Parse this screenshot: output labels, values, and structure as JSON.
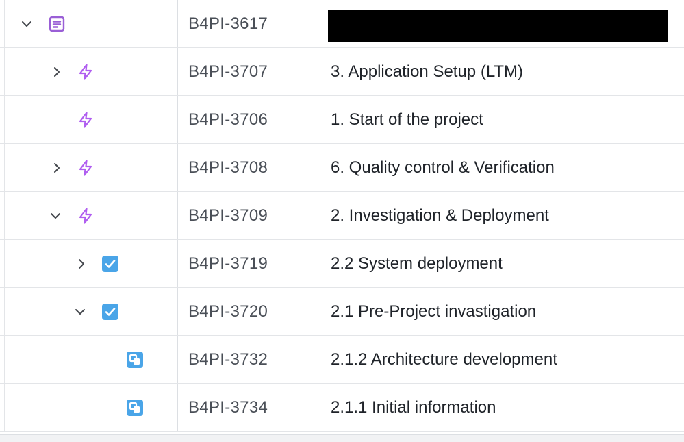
{
  "rows": [
    {
      "key": "B4PI-3617",
      "summary": "",
      "summary_redacted": true,
      "type_icon": "page-icon",
      "expander": "chevron-down-icon",
      "depth": 0
    },
    {
      "key": "B4PI-3707",
      "summary": "3. Application Setup (LTM)",
      "type_icon": "lightning-icon",
      "expander": "chevron-right-icon",
      "depth": 1
    },
    {
      "key": "B4PI-3706",
      "summary": "1. Start of the project",
      "type_icon": "lightning-icon",
      "expander": "",
      "depth": 1
    },
    {
      "key": "B4PI-3708",
      "summary": "6. Quality control & Verification",
      "type_icon": "lightning-icon",
      "expander": "chevron-right-icon",
      "depth": 1
    },
    {
      "key": "B4PI-3709",
      "summary": "2. Investigation & Deployment",
      "type_icon": "lightning-icon",
      "expander": "chevron-down-icon",
      "depth": 1
    },
    {
      "key": "B4PI-3719",
      "summary": "2.2 System deployment",
      "type_icon": "checkbox-task-icon",
      "expander": "chevron-right-icon",
      "depth": 2
    },
    {
      "key": "B4PI-3720",
      "summary": "2.1 Pre-Project invastigation",
      "type_icon": "checkbox-task-icon",
      "expander": "chevron-down-icon",
      "depth": 2
    },
    {
      "key": "B4PI-3732",
      "summary": "2.1.2 Architecture development",
      "type_icon": "subtask-icon",
      "expander": "",
      "depth": 3
    },
    {
      "key": "B4PI-3734",
      "summary": "2.1.1 Initial information",
      "type_icon": "subtask-icon",
      "expander": "",
      "depth": 3
    }
  ],
  "colors": {
    "epic_purple": "#9a5fd6",
    "lightning_purple": "#b05ef0",
    "task_blue": "#4aa5e8",
    "chevron": "#44474d"
  }
}
